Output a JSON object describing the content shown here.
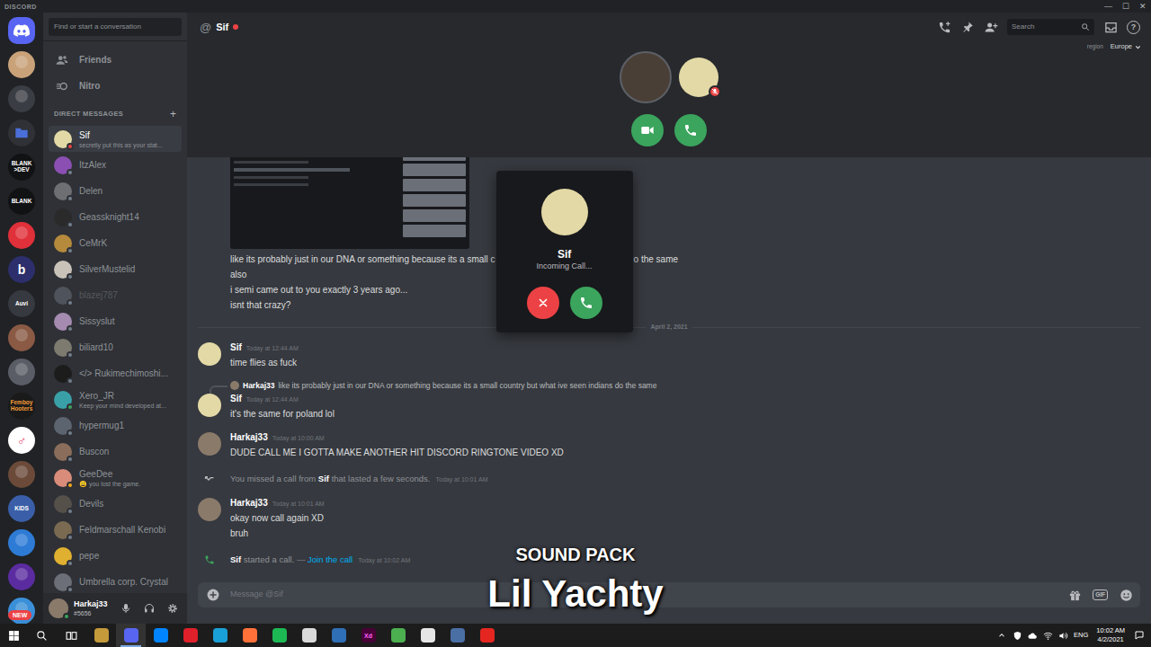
{
  "window": {
    "title": "DISCORD",
    "controls": [
      "—",
      "☐",
      "✕"
    ]
  },
  "rail": {
    "servers": [
      {
        "kind": "home",
        "color": "#5865f2"
      },
      {
        "kind": "image",
        "color": "#c9a27a"
      },
      {
        "kind": "image",
        "color": "#3a3d44"
      },
      {
        "kind": "folder",
        "color": "#4a6fd8"
      },
      {
        "kind": "text",
        "lines": [
          "BLANK",
          ">DEV"
        ],
        "color": "#111214",
        "text_color": "#ffffff"
      },
      {
        "kind": "text",
        "lines": [
          "BLANK"
        ],
        "color": "#111214",
        "text_color": "#ffffff"
      },
      {
        "kind": "image",
        "color": "#e0303a"
      },
      {
        "kind": "text",
        "lines": [
          "b"
        ],
        "color": "#2c2f6b",
        "text_color": "#ffffff"
      },
      {
        "kind": "text",
        "lines": [
          "Auvi"
        ],
        "color": "#36393f",
        "text_color": "#ffffff"
      },
      {
        "kind": "image",
        "color": "#8a5a44"
      },
      {
        "kind": "image",
        "color": "#5a5d66"
      },
      {
        "kind": "text",
        "lines": [
          "Femboy",
          "Hooters"
        ],
        "color": "#1a1a1a",
        "text_color": "#f29b38"
      },
      {
        "kind": "text",
        "lines": [
          "♂"
        ],
        "color": "#ffffff",
        "text_color": "#e8507a"
      },
      {
        "kind": "image",
        "color": "#6b4a3a"
      },
      {
        "kind": "text",
        "lines": [
          "KIDS"
        ],
        "color": "#3a5fa8",
        "text_color": "#ffffff"
      },
      {
        "kind": "image",
        "color": "#2e7bd6"
      },
      {
        "kind": "image",
        "color": "#5b2ca0"
      },
      {
        "kind": "image",
        "color": "#3a8fd8"
      }
    ],
    "badge": "NEW"
  },
  "sidebar": {
    "search_placeholder": "Find or start a conversation",
    "nav": [
      {
        "label": "Friends",
        "kind": "friends",
        "selected": false
      },
      {
        "label": "Nitro",
        "kind": "nitro",
        "selected": false
      }
    ],
    "section": "DIRECT MESSAGES",
    "add": "+",
    "dms": [
      {
        "name": "Sif",
        "subtitle": "secretly put this as your stat...",
        "status": "dnd",
        "avatar_color": "#e3d9a6",
        "selected": true,
        "greyed": false
      },
      {
        "name": "ItzAlex",
        "status": "offline",
        "avatar_color": "#8b4fb3",
        "selected": false,
        "greyed": false
      },
      {
        "name": "Delen",
        "status": "offline",
        "avatar_color": "#6d6f73",
        "selected": false,
        "greyed": false
      },
      {
        "name": "Geassknight14",
        "status": "offline",
        "avatar_color": "#2a2a2a",
        "selected": false,
        "greyed": false
      },
      {
        "name": "CeMrK",
        "status": "offline",
        "avatar_color": "#b58a3c",
        "selected": false,
        "greyed": false
      },
      {
        "name": "SilverMustelid",
        "status": "offline",
        "avatar_color": "#c9c2b8",
        "selected": false,
        "greyed": false
      },
      {
        "name": "blazej787",
        "status": "offline",
        "avatar_color": "#4f545c",
        "selected": false,
        "greyed": true
      },
      {
        "name": "Sissyslut",
        "status": "offline",
        "avatar_color": "#a58bb0",
        "selected": false,
        "greyed": false
      },
      {
        "name": "biliard10",
        "status": "offline",
        "avatar_color": "#7d7a70",
        "selected": false,
        "greyed": false
      },
      {
        "name": "</> Rukimechimoshi...",
        "status": "offline",
        "avatar_color": "#1c1c1c",
        "selected": false,
        "greyed": false
      },
      {
        "name": "Xero_JR",
        "subtitle": "Keep your mind developed at...",
        "status": "online",
        "avatar_color": "#3aa0a8",
        "selected": false,
        "greyed": false
      },
      {
        "name": "hypermug1",
        "status": "offline",
        "avatar_color": "#5c6470",
        "selected": false,
        "greyed": false
      },
      {
        "name": "Buscon",
        "status": "offline",
        "avatar_color": "#8a6d5a",
        "selected": false,
        "greyed": false
      },
      {
        "name": "GeeDee",
        "subtitle": "😩 you lost the game.",
        "status": "idle",
        "avatar_color": "#d98c7a",
        "selected": false,
        "greyed": false
      },
      {
        "name": "Devils",
        "status": "offline",
        "avatar_color": "#55504a",
        "selected": false,
        "greyed": false
      },
      {
        "name": "Feldmarschall Kenobi",
        "status": "offline",
        "avatar_color": "#7a6a52",
        "selected": false,
        "greyed": false
      },
      {
        "name": "pepe",
        "status": "offline",
        "avatar_color": "#e0b030",
        "selected": false,
        "greyed": false
      },
      {
        "name": "Umbrella corp. Crystal",
        "status": "offline",
        "avatar_color": "#6c6f78",
        "selected": false,
        "greyed": false
      }
    ],
    "user": {
      "name": "Harkaj33",
      "tag": "#5656",
      "status": "online",
      "avatar_color": "#8a7a6a"
    }
  },
  "header": {
    "icon": "@",
    "channel": "Sif",
    "status": "dnd",
    "search_placeholder": "Search",
    "help": "?"
  },
  "call": {
    "region_label": "region",
    "region": "Europe",
    "participants": [
      {
        "avatar_color": "#4a3f36",
        "muted": false
      },
      {
        "avatar_color": "#e3d9a6",
        "muted": true
      }
    ]
  },
  "incoming_call": {
    "name": "Sif",
    "status": "Incoming Call...",
    "avatar_color": "#e3d9a6"
  },
  "messages": [
    {
      "kind": "continuation",
      "has_image": true,
      "lines": [
        [
          "like its probably just in our DNA or something because its a small c",
          "o the same"
        ],
        [
          "also"
        ],
        [
          "i semi came out to you exactly 3 years ago..."
        ],
        [
          "isnt that crazy?"
        ]
      ]
    },
    {
      "kind": "divider",
      "date": "April 2, 2021"
    },
    {
      "kind": "message",
      "author": "Sif",
      "time": "Today at 12:44 AM",
      "avatar_color": "#e3d9a6",
      "lines": [
        [
          "time flies as fuck"
        ]
      ]
    },
    {
      "kind": "reply",
      "reply_author": "Harkaj33",
      "reply_avatar_color": "#8a7a6a",
      "reply_text": "like its probably just in our DNA or something because its a small country but what ive seen indians do the same",
      "author": "Sif",
      "time": "Today at 12:44 AM",
      "avatar_color": "#e3d9a6",
      "lines": [
        [
          "it's the same for poland lol"
        ]
      ]
    },
    {
      "kind": "message",
      "author": "Harkaj33",
      "time": "Today at 10:00 AM",
      "avatar_color": "#8a7a6a",
      "lines": [
        [
          "DUDE CALL ME I GOTTA MAKE ANOTHER HIT DISCORD RINGTONE VIDEO XD"
        ]
      ]
    },
    {
      "kind": "missed_call",
      "text": "You missed a call from ",
      "name": "Sif",
      "after": " that lasted a few seconds.",
      "time": "Today at 10:01 AM"
    },
    {
      "kind": "message",
      "author": "Harkaj33",
      "time": "Today at 10:01 AM",
      "avatar_color": "#8a7a6a",
      "lines": [
        [
          "okay now call again XD"
        ],
        [
          "bruh"
        ]
      ]
    },
    {
      "kind": "call_started",
      "name": "Sif",
      "text": " started a call. — ",
      "link": "Join the call",
      "time": "Today at 10:02 AM"
    }
  ],
  "compose": {
    "placeholder": "Message @Sif",
    "gif": "GIF"
  },
  "overlay": {
    "title": "SOUND PACK",
    "subtitle": "Lil Yachty"
  },
  "taskbar": {
    "apps": [
      {
        "color": "#c49a3a",
        "active": false
      },
      {
        "color": "#5865f2",
        "active": true
      },
      {
        "color": "#0084ff",
        "active": false
      },
      {
        "color": "#e0202a",
        "active": false
      },
      {
        "color": "#1aa0d8",
        "active": false
      },
      {
        "color": "#ff7139",
        "active": false
      },
      {
        "color": "#1db954",
        "active": false
      },
      {
        "color": "#d9d9d9",
        "active": false
      },
      {
        "color": "#2f6fb6",
        "active": false
      },
      {
        "color": "#470137",
        "active": false,
        "label": "Xd"
      },
      {
        "color": "#4caf50",
        "active": false
      },
      {
        "color": "#e6e6e6",
        "active": false
      },
      {
        "color": "#4a6fa5",
        "active": false
      },
      {
        "color": "#e52620",
        "active": false
      }
    ],
    "language": "ENG",
    "time": "10:02 AM",
    "date": "4/2/2021"
  }
}
